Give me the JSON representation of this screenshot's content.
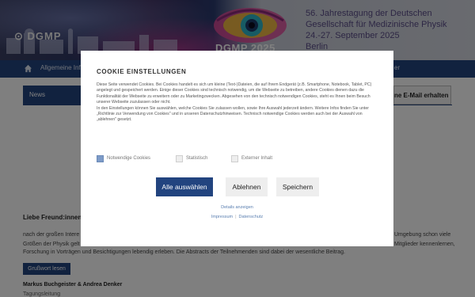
{
  "header": {
    "society_logo_text": "DGMP",
    "event_logo_text": "DGMP 2025",
    "conference_lines": [
      "56. Jahrestagung der Deutschen",
      "Gesellschaft für Medizinische Physik",
      "24.-27. September 2025",
      "Berlin"
    ]
  },
  "nav": {
    "home_icon": "home-icon",
    "item_first": "Allgemeine Infor",
    "item_right": "er"
  },
  "content": {
    "news_tab": "News",
    "newsletter_button": "ne E-Mail erhalten hal",
    "greeting": "Liebe Freund:innen de",
    "body_left": [
      "nach der großen Intere",
      "Größen der Physik gelte"
    ],
    "body_right": [
      "Umgebung schon viele",
      "Mitglieder kennenlernen,"
    ],
    "body_bottom": "Forschung in Vorträgen und Besichtigungen lebendig erleben. Die Abstracts der Teilnehmenden sind dabei der wesentliche Beitrag.",
    "grusswort_button": "Grußwort lesen",
    "signature": "Markus Buchgeister & Andrea Denker",
    "signature_role": "Tagungsleitung"
  },
  "cookie_modal": {
    "title": "COOKIE EINSTELLUNGEN",
    "paragraphs": [
      "Diese Seite verwendet Cookies. Bei Cookies handelt es sich um kleine (Text-)Dateien, die auf Ihrem Endgerät (z.B. Smartphone, Notebook, Tablet, PC) angelegt und gespeichert werden. Einige dieser Cookies sind technisch notwendig, um die Webseite zu betreiben, andere Cookies dienen dazu die Funktionalität der Webseite zu erweitern oder zu Marketingzwecken. Abgesehen von den technisch notwendigen Cookies, steht es Ihnen beim Besuch unserer Webseite zuzulassen oder nicht.",
      "In den Einstellungen können Sie auswählen, welche Cookies Sie zulassen wollen, sowie Ihre Auswahl jederzeit ändern. Weitere Infos finden Sie unter „Richtlinie zur Verwendung von Cookies\" und in unseren Datenschutzhinweisen. Technisch notwendige Cookies werden auch bei der Auswahl von „ablehnen\" gesetzt."
    ],
    "options": [
      {
        "label": "Notwendige Cookies",
        "checked": true
      },
      {
        "label": "Statistisch",
        "checked": false
      },
      {
        "label": "Externer Inhalt",
        "checked": false
      }
    ],
    "buttons": {
      "accept_all": "Alle auswählen",
      "reject": "Ablehnen",
      "save": "Speichern"
    },
    "details_link": "Details anzeigen",
    "footer_links": {
      "imprint": "Impressum",
      "separator": "|",
      "privacy": "Datenschutz"
    }
  },
  "colors": {
    "primary": "#22447f",
    "checkbox_checked": "#7d9bc8",
    "link": "#5a7fb0",
    "conference_text": "#5a4d88"
  }
}
